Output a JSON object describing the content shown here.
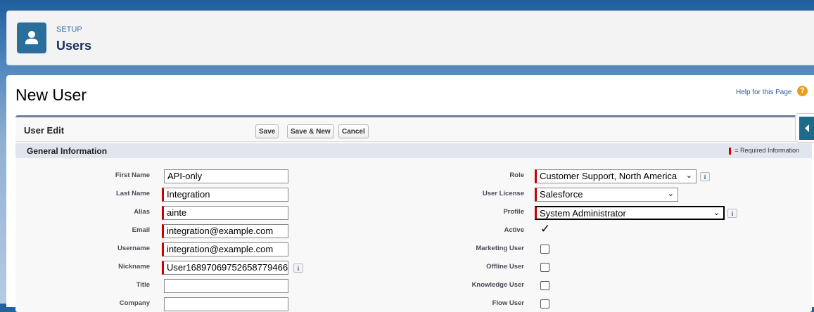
{
  "header": {
    "breadcrumb": "SETUP",
    "title": "Users",
    "icon": "user-icon"
  },
  "page": {
    "title": "New User",
    "help_link": "Help for this Page"
  },
  "block": {
    "title": "User Edit",
    "buttons": {
      "save": "Save",
      "save_new": "Save & New",
      "cancel": "Cancel"
    }
  },
  "section": {
    "title": "General Information",
    "required_legend": "= Required Information"
  },
  "left_fields": [
    {
      "label": "First Name",
      "value": "API-only",
      "required": false
    },
    {
      "label": "Last Name",
      "value": "Integration",
      "required": true
    },
    {
      "label": "Alias",
      "value": "ainte",
      "required": true
    },
    {
      "label": "Email",
      "value": "integration@example.com",
      "required": true
    },
    {
      "label": "Username",
      "value": "integration@example.com",
      "required": true
    },
    {
      "label": "Nickname",
      "value": "User16897069752658779466",
      "required": true
    },
    {
      "label": "Title",
      "value": "",
      "required": false
    },
    {
      "label": "Company",
      "value": "",
      "required": false
    }
  ],
  "right_fields": {
    "role": {
      "label": "Role",
      "value": "Customer Support, North America"
    },
    "license": {
      "label": "User License",
      "value": "Salesforce"
    },
    "profile": {
      "label": "Profile",
      "value": "System Administrator"
    },
    "active": {
      "label": "Active",
      "checked": true
    },
    "marketing": {
      "label": "Marketing User",
      "checked": false
    },
    "offline": {
      "label": "Offline User",
      "checked": false
    },
    "knowledge": {
      "label": "Knowledge User",
      "checked": false
    },
    "flow": {
      "label": "Flow User",
      "checked": false
    }
  }
}
